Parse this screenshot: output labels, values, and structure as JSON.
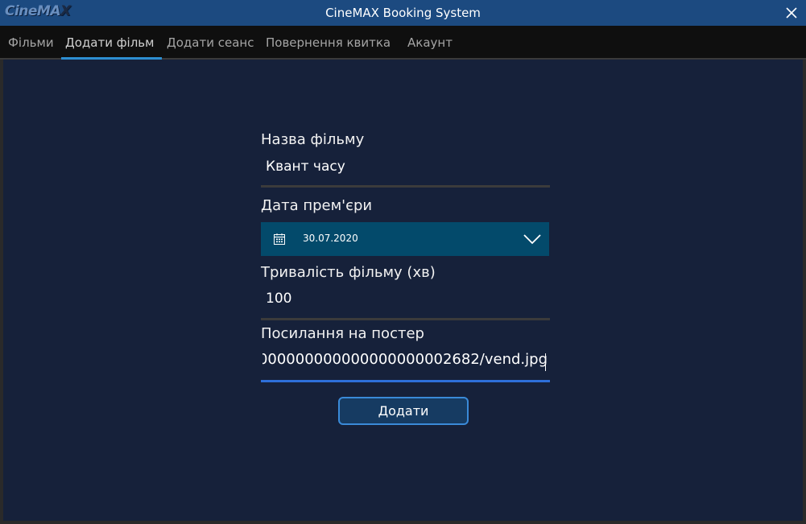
{
  "window": {
    "logo_text": "CineMAX",
    "title": "CineMAX Booking System",
    "close_icon": "close-icon"
  },
  "tabs": [
    {
      "label": "Фільми",
      "active": false
    },
    {
      "label": "Додати фільм",
      "active": true
    },
    {
      "label": "Додати сеанс",
      "active": false
    },
    {
      "label": "Повернення квитка",
      "active": false
    },
    {
      "label": "Акаунт",
      "active": false
    }
  ],
  "form": {
    "movie_name_label": "Назва фільму",
    "movie_name_value": "Квант часу",
    "premiere_label": "Дата прем'єри",
    "premiere_value": "30.07.2020",
    "duration_label": "Тривалість фільму (хв)",
    "duration_value": "100",
    "poster_label": "Посилання на постер",
    "poster_value": "000000000000000000002682/vend.jpg",
    "submit_label": "Додати"
  },
  "colors": {
    "titlebar": "#1c4a80",
    "background": "#16213a",
    "tab_accent": "#2d8ed0",
    "datepicker": "#034a6b",
    "focus_line": "#2e6fd9"
  }
}
